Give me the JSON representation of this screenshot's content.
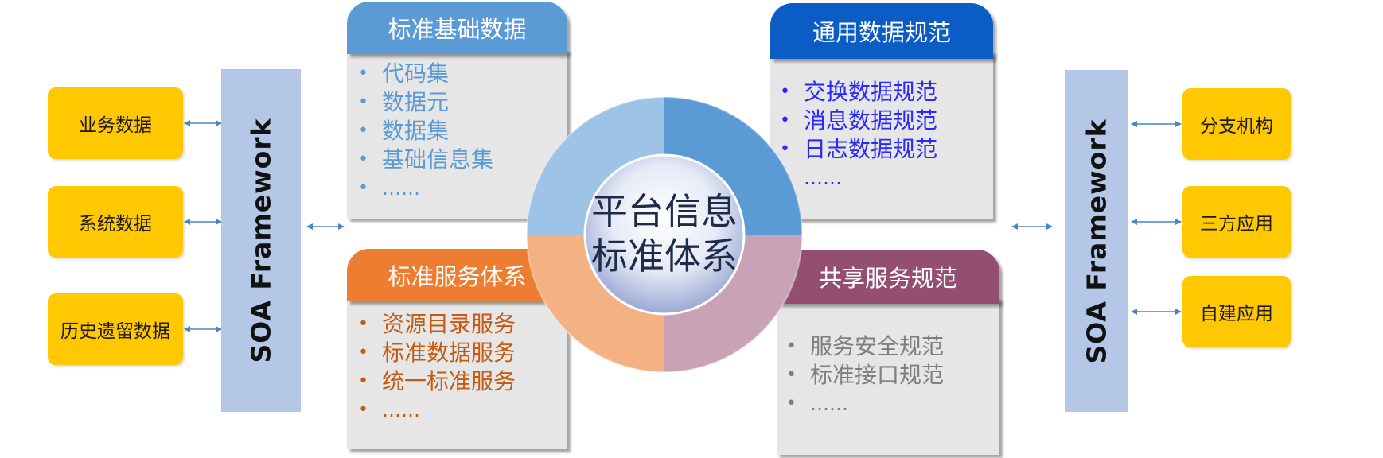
{
  "left_sources": [
    "业务数据",
    "系统数据",
    "历史遗留数据"
  ],
  "right_targets": [
    "分支机构",
    "三方应用",
    "自建应用"
  ],
  "soa_label": "SOA Framework",
  "center": {
    "line1": "平台信息",
    "line2": "标准体系"
  },
  "panels": {
    "top_left": {
      "title": "标准基础数据",
      "items": [
        "代码集",
        "数据元",
        "数据集",
        "基础信息集",
        "……"
      ],
      "header_color": "#5b9bd5",
      "text_color": "#5b9bd5"
    },
    "bottom_left": {
      "title": "标准服务体系",
      "items": [
        "资源目录服务",
        "标准数据服务",
        "统一标准服务",
        "……"
      ],
      "header_color": "#ed7d31",
      "text_color": "#c55a11"
    },
    "top_right": {
      "title": "通用数据规范",
      "items": [
        "交换数据规范",
        "消息数据规范",
        "日志数据规范",
        "……"
      ],
      "header_color": "#0b5cc5",
      "text_color": "#2929ff"
    },
    "bottom_right": {
      "title": "共享服务规范",
      "items": [
        "服务安全规范",
        "标准接口规范",
        "……"
      ],
      "header_color": "#944e72",
      "text_color": "#7f7f7f"
    }
  },
  "colors": {
    "source_box": "#ffc800",
    "soa_bar": "#b4c7e7",
    "arrow": "#4a86c5",
    "ring_tl": "#9dc3e6",
    "ring_tr": "#5b9bd5",
    "ring_bl": "#f4b183",
    "ring_br": "#c9a3b5"
  }
}
